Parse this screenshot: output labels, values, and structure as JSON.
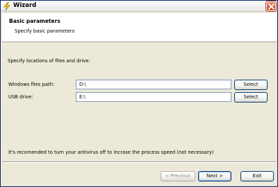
{
  "window": {
    "title": "Wizard",
    "app_icon": "lightning-icon",
    "close_icon": "close-icon"
  },
  "header": {
    "title": "Basic parameters",
    "subtitle": "Specify basic parameters"
  },
  "main": {
    "instructions": "Specify locations of files and drive:",
    "fields": [
      {
        "label": "Windows files path:",
        "value": "D:\\",
        "button_label": "Select"
      },
      {
        "label": "USB drive:",
        "value": "E:\\",
        "button_label": "Select"
      }
    ],
    "note": "It's recomended to turn your antivirus off to incrase the process speed (not necessary)"
  },
  "footer": {
    "previous_label": "< Previous",
    "next_label": "Next >",
    "exit_label": "Exit"
  },
  "colors": {
    "window_bg": "#ece9d8",
    "border": "#0a246a",
    "close_button": "#c84222"
  }
}
